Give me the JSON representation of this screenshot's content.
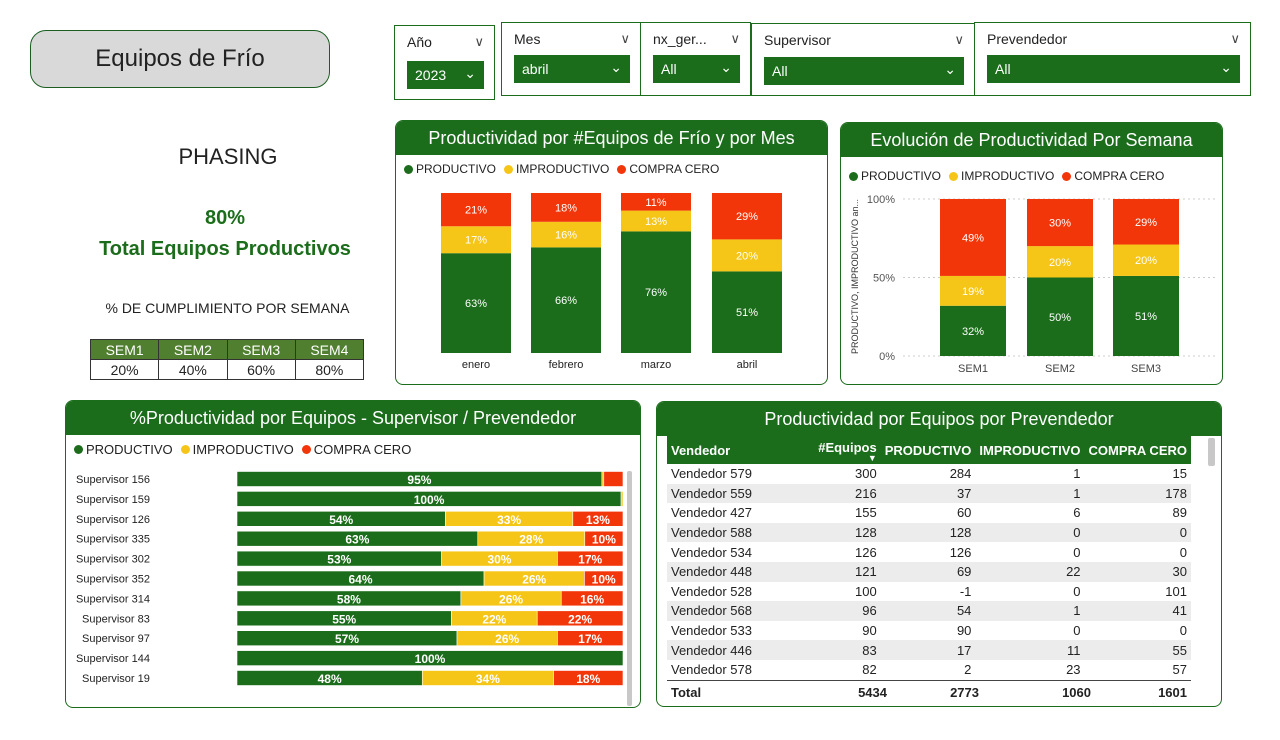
{
  "title": "Equipos de Frío",
  "slicers": {
    "anio": {
      "label": "Año",
      "value": "2023"
    },
    "mes": {
      "label": "Mes",
      "value": "abril"
    },
    "nx_ger": {
      "label": "nx_ger...",
      "value": "All"
    },
    "supervisor": {
      "label": "Supervisor",
      "value": "All"
    },
    "prevendedor": {
      "label": "Prevendedor",
      "value": "All"
    }
  },
  "phasing": {
    "title": "PHASING",
    "kpi_value": "80%",
    "kpi_label": "Total Equipos Productivos",
    "cumplimiento_title": "% DE CUMPLIMIENTO POR SEMANA",
    "weeks": [
      "SEM1",
      "SEM2",
      "SEM3",
      "SEM4"
    ],
    "week_values": [
      "20%",
      "40%",
      "60%",
      "80%"
    ]
  },
  "colors": {
    "productivo": "#1b6d1b",
    "improductivo": "#f5c518",
    "compra_cero": "#f2360a",
    "header": "#1b6d1b"
  },
  "legend": {
    "productivo": "PRODUCTIVO",
    "improductivo": "IMPRODUCTIVO",
    "compra_cero": "COMPRA CERO"
  },
  "chart_data": [
    {
      "id": "por_mes",
      "type": "bar",
      "stacked": true,
      "title": "Productividad por #Equipos de Frío y por Mes",
      "categories": [
        "enero",
        "febrero",
        "marzo",
        "abril"
      ],
      "series": [
        {
          "name": "PRODUCTIVO",
          "values": [
            63,
            66,
            76,
            51
          ]
        },
        {
          "name": "IMPRODUCTIVO",
          "values": [
            17,
            16,
            13,
            20
          ]
        },
        {
          "name": "COMPRA CERO",
          "values": [
            21,
            18,
            11,
            29
          ]
        }
      ],
      "legend_position": "top-left"
    },
    {
      "id": "por_semana",
      "type": "bar",
      "stacked": true,
      "title": "Evolución de Productividad Por Semana",
      "categories": [
        "SEM1",
        "SEM2",
        "SEM3"
      ],
      "series": [
        {
          "name": "PRODUCTIVO",
          "values": [
            32,
            50,
            51
          ]
        },
        {
          "name": "IMPRODUCTIVO",
          "values": [
            19,
            20,
            20
          ]
        },
        {
          "name": "COMPRA CERO",
          "values": [
            49,
            30,
            29
          ]
        }
      ],
      "ylabel": "PRODUCTIVO, IMPRODUCTIVO an...",
      "yticks": [
        "100%",
        "50%",
        "0%"
      ],
      "ylim": [
        0,
        100
      ],
      "grid": true,
      "legend_position": "top-left"
    },
    {
      "id": "por_supervisor",
      "type": "bar",
      "orientation": "horizontal",
      "stacked": true,
      "title": "%Productividad por Equipos - Supervisor / Prevendedor",
      "categories": [
        "Supervisor 156",
        "Supervisor 159",
        "Supervisor 126",
        "Supervisor 335",
        "Supervisor 302",
        "Supervisor 352",
        "Supervisor 314",
        "Supervisor 83",
        "Supervisor 97",
        "Supervisor 144",
        "Supervisor 19"
      ],
      "series": [
        {
          "name": "PRODUCTIVO",
          "values": [
            95,
            100,
            54,
            63,
            53,
            64,
            58,
            55,
            57,
            100,
            48
          ]
        },
        {
          "name": "IMPRODUCTIVO",
          "values": [
            0.5,
            0.5,
            33,
            28,
            30,
            26,
            26,
            22,
            26,
            0,
            34
          ]
        },
        {
          "name": "COMPRA CERO",
          "values": [
            5,
            0,
            13,
            10,
            17,
            10,
            16,
            22,
            17,
            0,
            18
          ]
        }
      ],
      "data_labels": {
        "PRODUCTIVO": [
          "95%",
          "100%",
          "54%",
          "63%",
          "53%",
          "64%",
          "58%",
          "55%",
          "57%",
          "100%",
          "48%"
        ],
        "IMPRODUCTIVO": [
          "",
          "",
          "33%",
          "28%",
          "30%",
          "26%",
          "26%",
          "22%",
          "26%",
          "",
          "34%"
        ],
        "COMPRA CERO": [
          "",
          "",
          "13%",
          "10%",
          "17%",
          "10%",
          "16%",
          "22%",
          "17%",
          "",
          "18%"
        ]
      },
      "legend_position": "top-left"
    }
  ],
  "vendor_table": {
    "title": "Productividad por Equipos por Prevendedor",
    "columns": [
      "Vendedor",
      "#Equipos",
      "PRODUCTIVO",
      "IMPRODUCTIVO",
      "COMPRA CERO"
    ],
    "rows": [
      [
        "Vendedor 579",
        "300",
        "284",
        "1",
        "15"
      ],
      [
        "Vendedor 559",
        "216",
        "37",
        "1",
        "178"
      ],
      [
        "Vendedor 427",
        "155",
        "60",
        "6",
        "89"
      ],
      [
        "Vendedor 588",
        "128",
        "128",
        "0",
        "0"
      ],
      [
        "Vendedor 534",
        "126",
        "126",
        "0",
        "0"
      ],
      [
        "Vendedor 448",
        "121",
        "69",
        "22",
        "30"
      ],
      [
        "Vendedor 528",
        "100",
        "-1",
        "0",
        "101"
      ],
      [
        "Vendedor 568",
        "96",
        "54",
        "1",
        "41"
      ],
      [
        "Vendedor 533",
        "90",
        "90",
        "0",
        "0"
      ],
      [
        "Vendedor 446",
        "83",
        "17",
        "11",
        "55"
      ],
      [
        "Vendedor 578",
        "82",
        "2",
        "23",
        "57"
      ]
    ],
    "total": [
      "Total",
      "5434",
      "2773",
      "1060",
      "1601"
    ]
  }
}
